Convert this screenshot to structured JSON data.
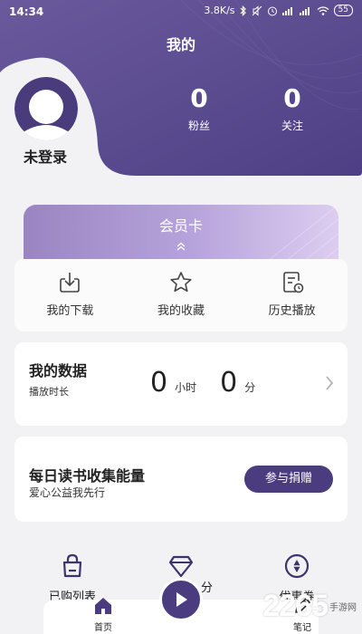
{
  "status_bar": {
    "time": "14:34",
    "network_speed": "3.8K/s",
    "battery": "55"
  },
  "header": {
    "title": "我的",
    "login_status": "未登录",
    "stats": [
      {
        "value": "0",
        "label": "粉丝"
      },
      {
        "value": "0",
        "label": "关注"
      }
    ]
  },
  "vip_card": {
    "title": "会员卡"
  },
  "quick_actions": [
    {
      "label": "我的下载",
      "icon": "download-icon"
    },
    {
      "label": "我的收藏",
      "icon": "star-icon"
    },
    {
      "label": "历史播放",
      "icon": "history-icon"
    }
  ],
  "my_data": {
    "title": "我的数据",
    "subtitle": "播放时长",
    "hours": "0",
    "hours_unit": "小时",
    "minutes": "0",
    "minutes_unit": "分"
  },
  "charity": {
    "title": "每日读书收集能量",
    "subtitle": "爱心公益我先行",
    "button": "参与捐赠"
  },
  "bottom_menu": {
    "purchased": "已购列表",
    "middle_suffix": "分",
    "coupon": "优惠券"
  },
  "tabbar": {
    "home": "首页",
    "notes": "笔记"
  },
  "colors": {
    "primary": "#4b3c80",
    "header_bg": "#5b4a8f",
    "vip_gradient_start": "#9a85c2",
    "vip_gradient_end": "#dccdf0"
  },
  "watermark": {
    "number": "2265",
    "text": "手游网"
  }
}
